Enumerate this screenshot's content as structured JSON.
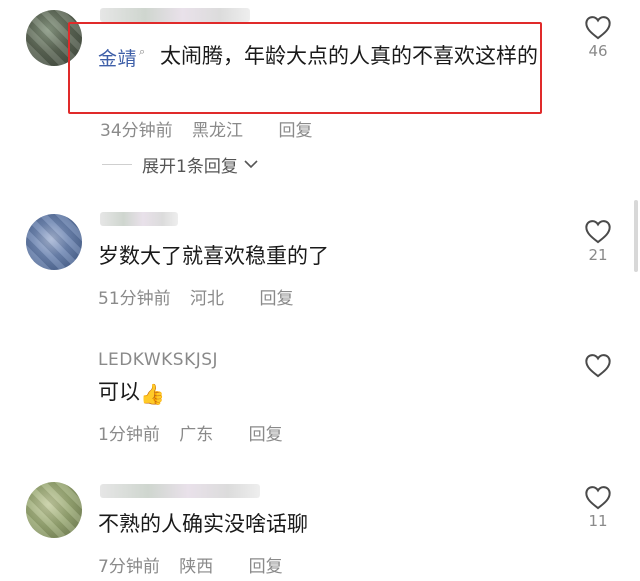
{
  "comments": [
    {
      "username": "金靖",
      "text": "太闹腾，年龄大点的人真的不喜欢这样的",
      "time": "34分钟前",
      "location": "黑龙江",
      "reply": "回复",
      "likes": "46",
      "expand": "展开1条回复"
    },
    {
      "username": "",
      "text": "岁数大了就喜欢稳重的了",
      "time": "51分钟前",
      "location": "河北",
      "reply": "回复",
      "likes": "21"
    },
    {
      "username": "LEDKWKSKJSJ",
      "text": "可以",
      "emoji": "👍",
      "time": "1分钟前",
      "location": "广东",
      "reply": "回复",
      "likes": ""
    },
    {
      "username": "",
      "text": "不熟的人确实没啥话聊",
      "time": "7分钟前",
      "location": "陕西",
      "reply": "回复",
      "likes": "11"
    }
  ],
  "colors": {
    "highlight": "#e02a2a",
    "username_blue": "#3e5fa8",
    "meta_gray": "#8a8a8a"
  },
  "icons": {
    "like": "heart-outline-icon",
    "expand": "chevron-down-icon"
  }
}
